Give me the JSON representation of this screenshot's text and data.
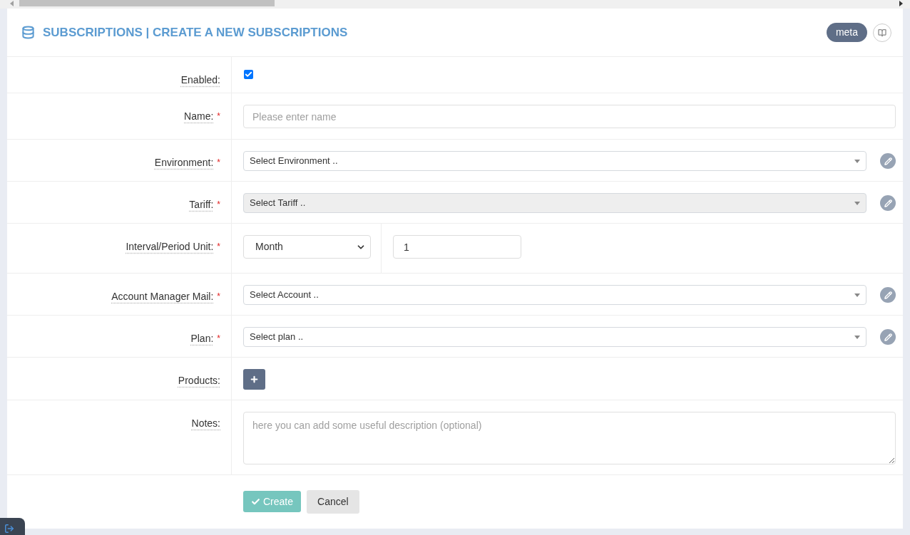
{
  "header": {
    "title": "SUBSCRIPTIONS | CREATE A NEW SUBSCRIPTIONS",
    "badge": "meta"
  },
  "fields": [
    {
      "kind": "checkbox",
      "label": "Enabled:",
      "checked": true
    },
    {
      "kind": "text",
      "label": "Name:",
      "required_mark": "*",
      "placeholder": "Please enter name"
    },
    {
      "kind": "select",
      "label": "Environment:",
      "required_mark": "*",
      "placeholder": "Select Environment ..",
      "disabled": false
    },
    {
      "kind": "select",
      "label": "Tariff:",
      "required_mark": "*",
      "placeholder": "Select Tariff ..",
      "disabled": true
    },
    {
      "kind": "interval",
      "label": "Interval/Period Unit:",
      "required_mark": "*",
      "unit": "Month",
      "value": "1"
    },
    {
      "kind": "select",
      "label": "Account Manager Mail:",
      "required_mark": "*",
      "placeholder": "Select Account ..",
      "disabled": false
    },
    {
      "kind": "select",
      "label": "Plan:",
      "required_mark": "*",
      "placeholder": "Select plan ..",
      "disabled": false
    },
    {
      "kind": "add",
      "label": "Products:"
    },
    {
      "kind": "textarea",
      "label": "Notes:",
      "placeholder": "here you can add some useful description (optional)"
    }
  ],
  "actions": [
    {
      "kind": "primary",
      "label": "Create",
      "disabled": true
    },
    {
      "kind": "secondary",
      "label": "Cancel",
      "disabled": false
    }
  ]
}
